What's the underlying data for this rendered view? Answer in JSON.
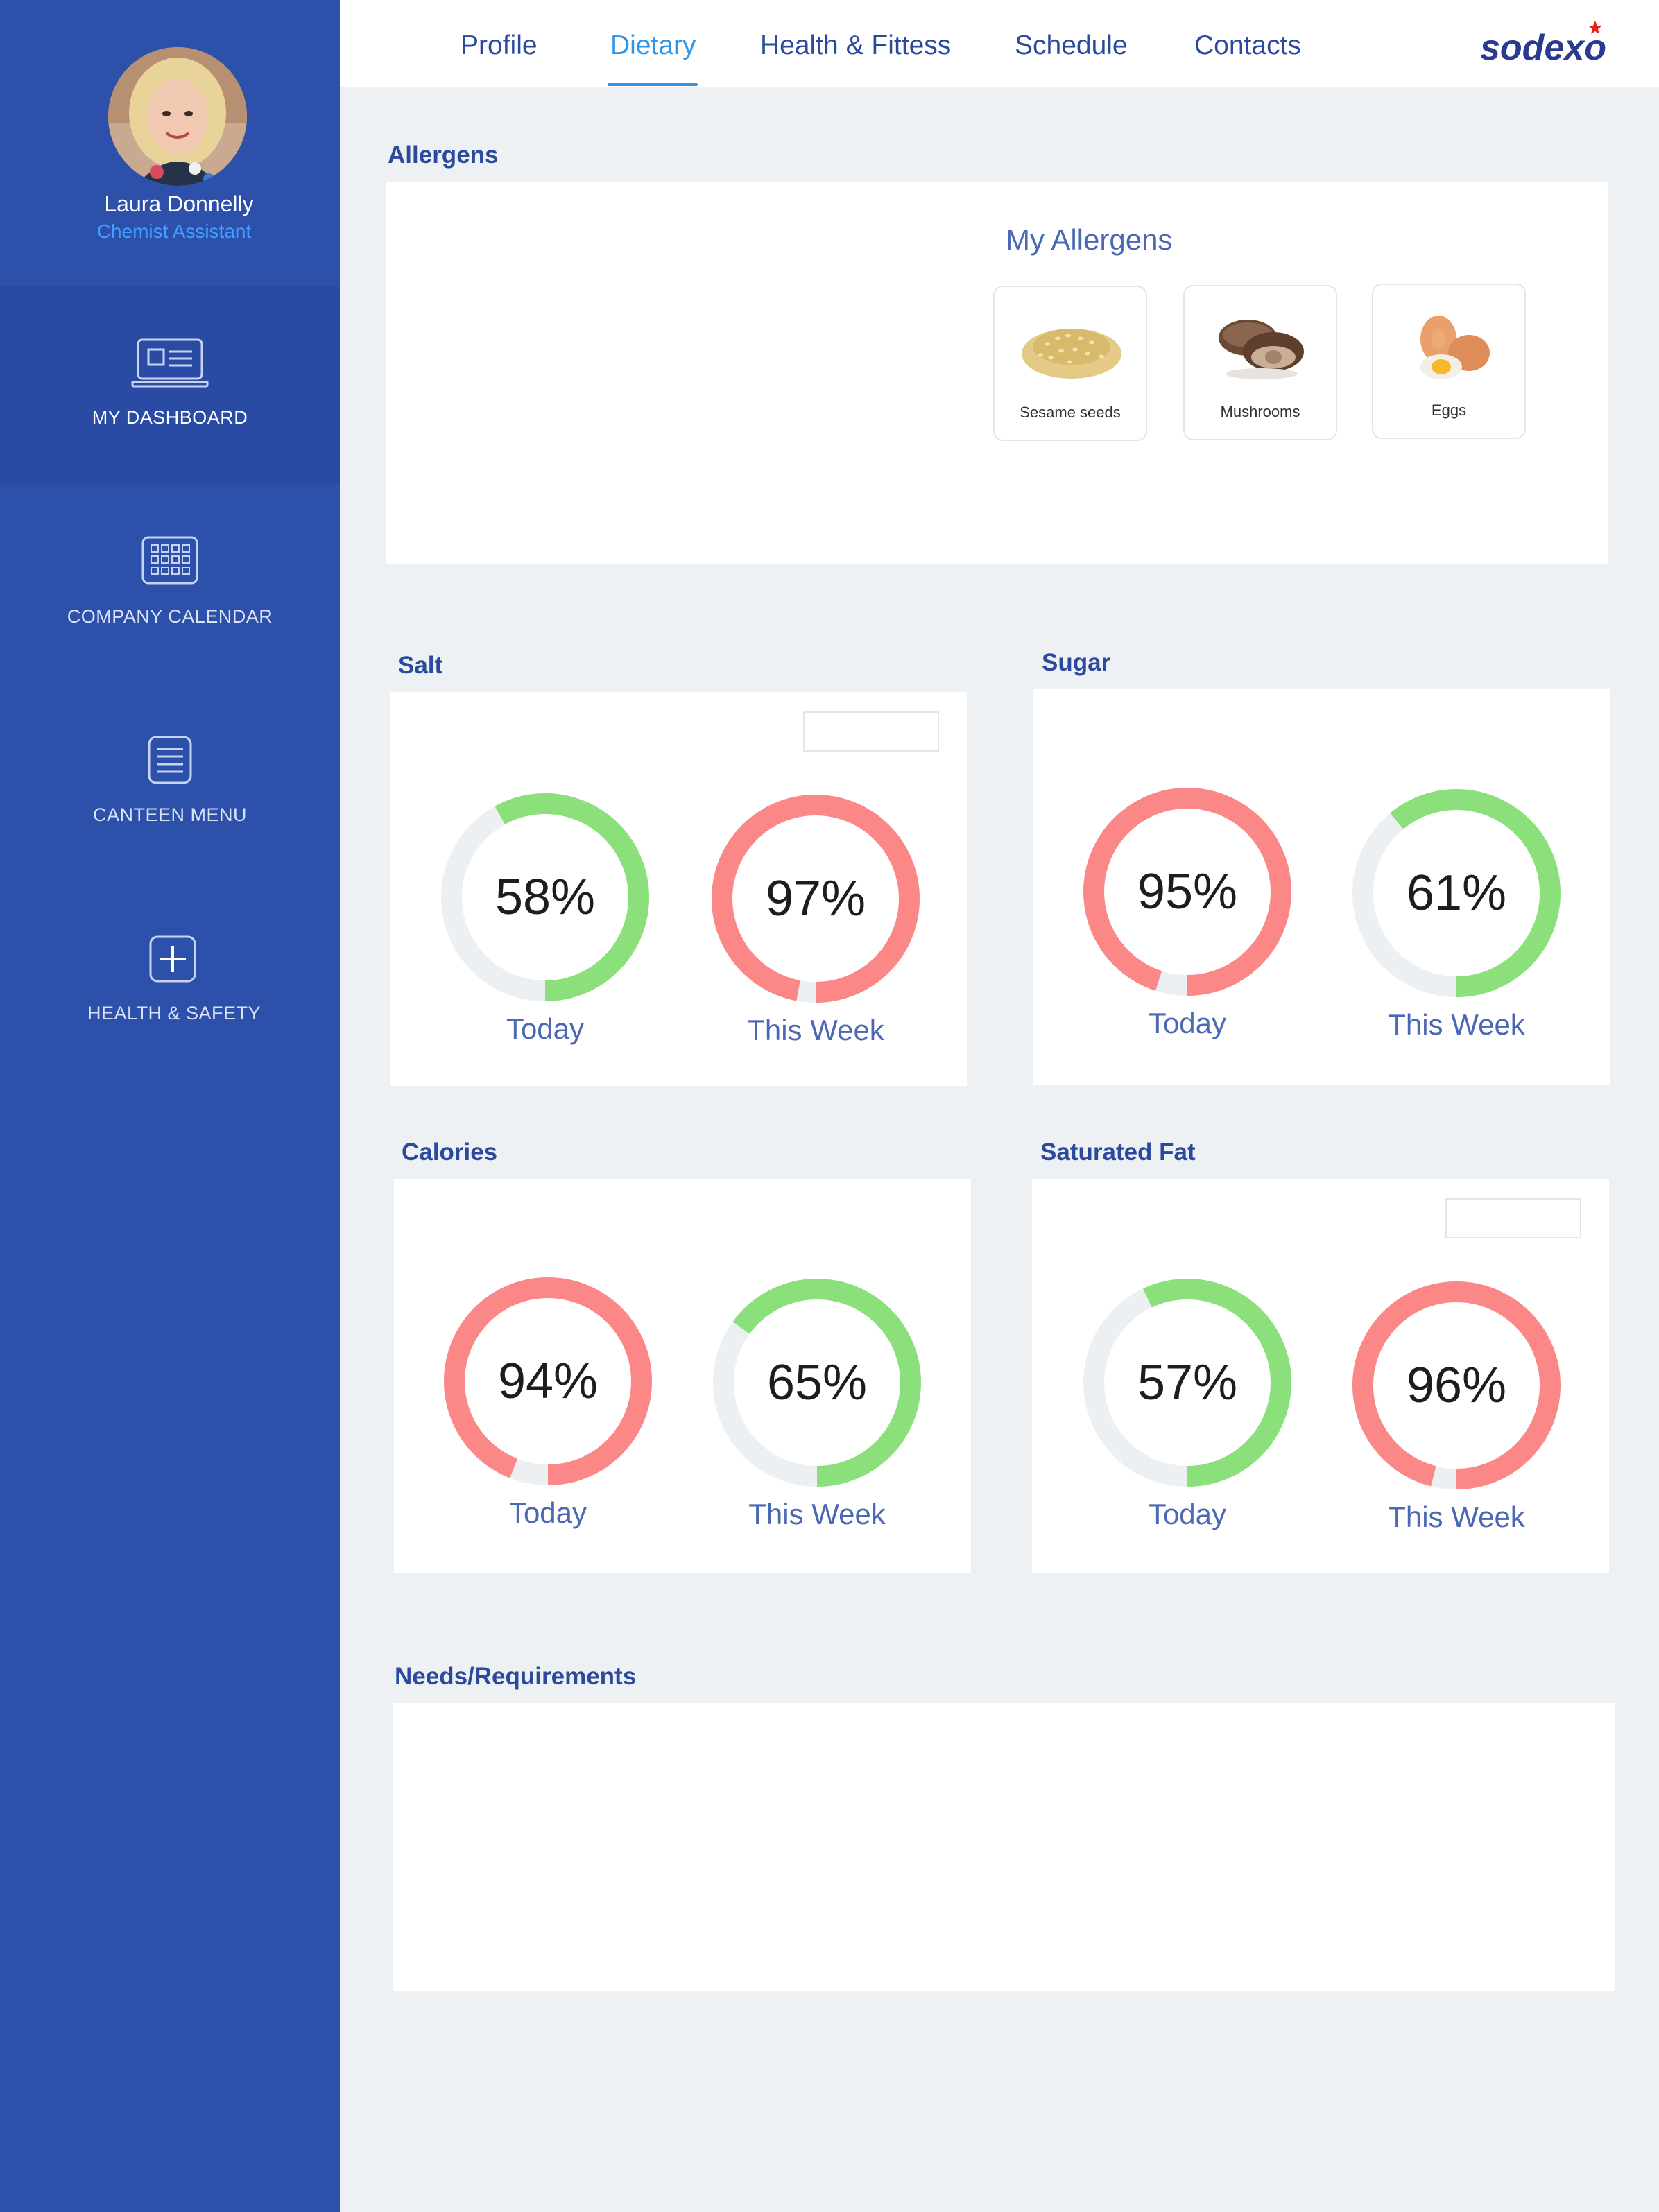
{
  "colors": {
    "sidebar": "#2d50ab",
    "sidebar_active": "#2a4ba3",
    "accent": "#2e95e8",
    "good": "#8be07c",
    "bad": "#fb8787",
    "track": "#ecf0f3"
  },
  "user": {
    "name": "Laura Donnelly",
    "role": "Chemist Assistant"
  },
  "sidebar": {
    "items": [
      {
        "label": "MY DASHBOARD",
        "icon": "laptop-icon",
        "active": true
      },
      {
        "label": "COMPANY CALENDAR",
        "icon": "calendar-icon",
        "active": false
      },
      {
        "label": "CANTEEN MENU",
        "icon": "menu-list-icon",
        "active": false
      },
      {
        "label": "HEALTH & SAFETY",
        "icon": "plus-icon",
        "active": false
      }
    ]
  },
  "tabs": [
    {
      "label": "Profile",
      "active": false
    },
    {
      "label": "Dietary",
      "active": true
    },
    {
      "label": "Health & Fittess",
      "active": false
    },
    {
      "label": "Schedule",
      "active": false
    },
    {
      "label": "Contacts",
      "active": false
    }
  ],
  "logo": "sodexo",
  "allergens": {
    "title": "Allergens",
    "subtitle": "My Allergens",
    "items": [
      {
        "label": "Sesame seeds",
        "icon": "sesame-seeds-icon"
      },
      {
        "label": "Mushrooms",
        "icon": "mushrooms-icon"
      },
      {
        "label": "Eggs",
        "icon": "eggs-icon"
      }
    ]
  },
  "metrics": [
    {
      "title": "Salt",
      "gauges": [
        {
          "label": "Today",
          "value": 58,
          "display": "58%",
          "status": "good"
        },
        {
          "label": "This Week",
          "value": 97,
          "display": "97%",
          "status": "bad"
        }
      ]
    },
    {
      "title": "Sugar",
      "gauges": [
        {
          "label": "Today",
          "value": 95,
          "display": "95%",
          "status": "bad"
        },
        {
          "label": "This Week",
          "value": 61,
          "display": "61%",
          "status": "good"
        }
      ]
    },
    {
      "title": "Calories",
      "gauges": [
        {
          "label": "Today",
          "value": 94,
          "display": "94%",
          "status": "bad"
        },
        {
          "label": "This Week",
          "value": 65,
          "display": "65%",
          "status": "good"
        }
      ]
    },
    {
      "title": "Saturated Fat",
      "gauges": [
        {
          "label": "Today",
          "value": 57,
          "display": "57%",
          "status": "good"
        },
        {
          "label": "This Week",
          "value": 96,
          "display": "96%",
          "status": "bad"
        }
      ]
    }
  ],
  "needs": {
    "title": "Needs/Requirements"
  }
}
